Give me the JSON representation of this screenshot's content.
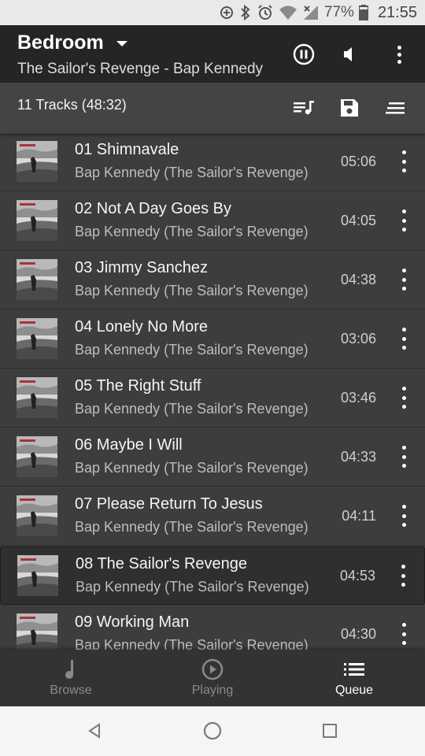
{
  "status_bar": {
    "battery": "77%",
    "time": "21:55",
    "icons": [
      "data-saver-icon",
      "bluetooth-icon",
      "alarm-icon",
      "wifi-icon",
      "signal-icon",
      "battery-icon"
    ]
  },
  "header": {
    "room": "Bedroom",
    "now_playing": "The Sailor's Revenge - Bap Kennedy",
    "icons": [
      "pause-icon",
      "volume-icon",
      "more-vert-icon"
    ]
  },
  "queue_bar": {
    "track_count": "11 Tracks (48:32)",
    "icons": [
      "playlist-icon",
      "save-icon",
      "sort-icon"
    ]
  },
  "tracks": [
    {
      "title": "01 Shimnavale",
      "subtitle": "Bap Kennedy (The Sailor's Revenge)",
      "duration": "05:06",
      "active": false
    },
    {
      "title": "02 Not A Day Goes By",
      "subtitle": "Bap Kennedy (The Sailor's Revenge)",
      "duration": "04:05",
      "active": false
    },
    {
      "title": "03 Jimmy Sanchez",
      "subtitle": "Bap Kennedy (The Sailor's Revenge)",
      "duration": "04:38",
      "active": false
    },
    {
      "title": "04 Lonely No More",
      "subtitle": "Bap Kennedy (The Sailor's Revenge)",
      "duration": "03:06",
      "active": false
    },
    {
      "title": "05 The Right Stuff",
      "subtitle": "Bap Kennedy (The Sailor's Revenge)",
      "duration": "03:46",
      "active": false
    },
    {
      "title": "06 Maybe I Will",
      "subtitle": "Bap Kennedy (The Sailor's Revenge)",
      "duration": "04:33",
      "active": false
    },
    {
      "title": "07 Please Return To Jesus",
      "subtitle": "Bap Kennedy (The Sailor's Revenge)",
      "duration": "04:11",
      "active": false
    },
    {
      "title": "08 The Sailor's Revenge",
      "subtitle": "Bap Kennedy (The Sailor's Revenge)",
      "duration": "04:53",
      "active": true
    },
    {
      "title": "09 Working Man",
      "subtitle": "Bap Kennedy (The Sailor's Revenge)",
      "duration": "04:30",
      "active": false
    }
  ],
  "bottom_nav": {
    "browse": "Browse",
    "playing": "Playing",
    "queue": "Queue",
    "selected": "queue"
  },
  "system_nav": [
    "back-icon",
    "home-icon",
    "recents-icon"
  ]
}
